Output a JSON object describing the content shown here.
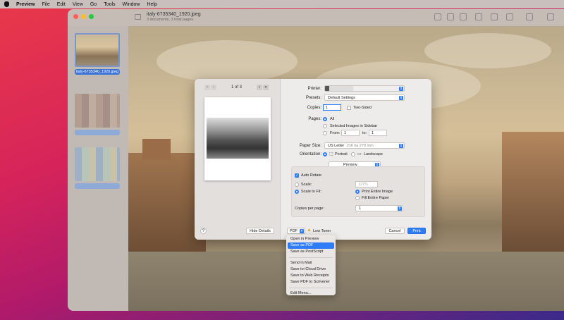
{
  "menubar": {
    "items": [
      "Preview",
      "File",
      "Edit",
      "View",
      "Go",
      "Tools",
      "Window",
      "Help"
    ]
  },
  "window": {
    "title": "italy-6735340_1920.jpeg",
    "subtitle": "3 documents, 3 total pages",
    "sidebar": {
      "selected_caption": "italy-6735340_1920.jpeg"
    }
  },
  "dialog": {
    "page_indicator": "1 of 3",
    "printer_label": "Printer:",
    "presets_label": "Presets:",
    "presets_value": "Default Settings",
    "copies_label": "Copies:",
    "copies_value": "1",
    "two_sided": "Two-Sided",
    "pages_label": "Pages:",
    "pages_all": "All",
    "pages_selected": "Selected Images in Sidebar",
    "pages_from": "From:",
    "from_value": "1",
    "to_label": "to:",
    "to_value": "1",
    "paper_size_label": "Paper Size:",
    "paper_size_value": "US Letter",
    "paper_size_dims": "216 by 279 mm",
    "orientation_label": "Orientation:",
    "portrait": "Portrait",
    "landscape": "Landscape",
    "section_popup": "Preview",
    "auto_rotate": "Auto Rotate",
    "scale": "Scale:",
    "scale_value": "127%",
    "scale_to_fit": "Scale to Fit:",
    "print_entire_image": "Print Entire Image",
    "fill_entire_paper": "Fill Entire Paper",
    "copies_per_page_label": "Copies per page:",
    "copies_per_page_value": "1",
    "help": "?",
    "hide_details": "Hide Details",
    "pdf": "PDF",
    "low_toner": "Low Toner",
    "cancel": "Cancel",
    "print": "Print"
  },
  "pdf_menu": {
    "items": [
      "Open in Preview",
      "Save as PDF",
      "Save as PostScript",
      "Send in Mail",
      "Save to iCloud Drive",
      "Save to Web Receipts",
      "Save PDF to Scrivener",
      "Edit Menu..."
    ],
    "selected": "Save as PDF"
  },
  "colors": {
    "accent": "#2e7cf6",
    "close": "#ff5f57",
    "minimize": "#febc2e",
    "zoom": "#28c840"
  }
}
